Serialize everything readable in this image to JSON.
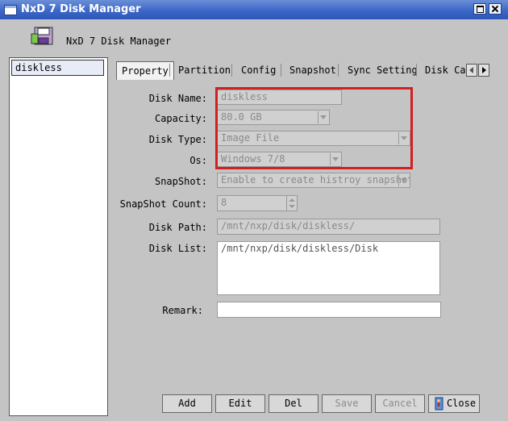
{
  "window": {
    "title": "NxD 7 Disk Manager"
  },
  "app": {
    "name": "NxD 7 Disk Manager"
  },
  "sidebar": {
    "items": [
      {
        "label": "diskless"
      }
    ]
  },
  "tabs": [
    {
      "label": "Property"
    },
    {
      "label": "Partition"
    },
    {
      "label": "Config"
    },
    {
      "label": "Snapshot"
    },
    {
      "label": "Sync Setting"
    },
    {
      "label": "Disk Cache"
    }
  ],
  "form": {
    "disk_name": {
      "label": "Disk Name:",
      "value": "diskless"
    },
    "capacity": {
      "label": "Capacity:",
      "value": "80.0 GB"
    },
    "disk_type": {
      "label": "Disk Type:",
      "value": "Image File"
    },
    "os": {
      "label": "Os:",
      "value": "Windows 7/8"
    },
    "snapshot": {
      "label": "SnapShot:",
      "value": "Enable to create histroy snapshot"
    },
    "snapshot_count": {
      "label": "SnapShot Count:",
      "value": "8"
    },
    "disk_path": {
      "label": "Disk Path:",
      "value": "/mnt/nxp/disk/diskless/"
    },
    "disk_list": {
      "label": "Disk List:",
      "value": "/mnt/nxp/disk/diskless/Disk"
    },
    "remark": {
      "label": "Remark:",
      "value": ""
    }
  },
  "buttons": {
    "add": "Add",
    "edit": "Edit",
    "del": "Del",
    "save": "Save",
    "cancel": "Cancel",
    "close": "Close"
  },
  "colors": {
    "titlebar": "#3c67c8",
    "highlight": "#d21f1f"
  }
}
